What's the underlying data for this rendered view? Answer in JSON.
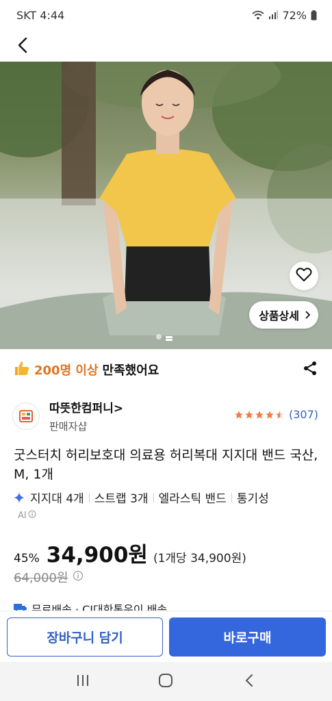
{
  "status_bar": {
    "carrier_time": "SKT 4:44",
    "battery": "72%"
  },
  "hero": {
    "detail_button": "상품상세"
  },
  "satisfaction": {
    "count": "200명 이상",
    "suffix": "만족했어요"
  },
  "seller": {
    "name": "따뜻한컴퍼니",
    "chevron": ">",
    "subtitle": "판매자샵",
    "rating": 4.5,
    "review_count": "(307)"
  },
  "product": {
    "title": "굿스터치 허리보호대 의료용 허리복대 지지대 밴드 국산, M, 1개",
    "tags": [
      "지지대 4개",
      "스트랩 3개",
      "엘라스틱 밴드",
      "통기성"
    ],
    "ai_label": "AI"
  },
  "price": {
    "discount": "45%",
    "sale": "34,900원",
    "unit": "(1개당 34,900원)",
    "original": "64,000원"
  },
  "shipping": {
    "text": "무료배송 · CJ대한통운이 배송"
  },
  "actions": {
    "cart": "장바구니 담기",
    "buy": "바로구매"
  },
  "colors": {
    "accent_blue": "#3466dd",
    "satisfaction_orange": "#e0741d",
    "star_orange": "#f07b3f",
    "review_blue": "#3460b8"
  }
}
